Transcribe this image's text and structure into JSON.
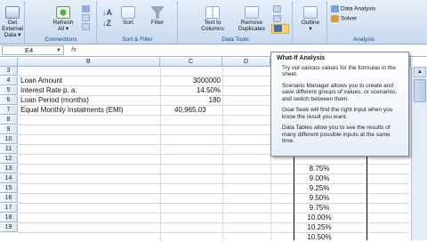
{
  "ribbon": {
    "get_external_data": {
      "line1": "Get External",
      "line2": "Data ▾"
    },
    "connections": {
      "refresh_line1": "Refresh",
      "refresh_line2": "All ▾",
      "group_label": "Connections"
    },
    "sort_filter": {
      "sort": "Sort",
      "filter": "Filter",
      "group_label": "Sort & Filter"
    },
    "data_tools": {
      "text_to_columns_line1": "Text to",
      "text_to_columns_line2": "Columns",
      "remove_duplicates_line1": "Remove",
      "remove_duplicates_line2": "Duplicates",
      "group_label": "Data Tools"
    },
    "outline": {
      "label": "Outline",
      "arrow": "▾"
    },
    "analysis": {
      "data_analysis": "Data Analysis",
      "solver": "Solver",
      "group_label": "Analysis"
    }
  },
  "formula_bar": {
    "name_box": "E4",
    "fx": "fx"
  },
  "columns": [
    "B",
    "C",
    "D"
  ],
  "rows": [
    "3",
    "4",
    "5",
    "6",
    "7",
    "8",
    "9",
    "10",
    "11",
    "12",
    "13",
    "14",
    "15",
    "16",
    "17",
    "18",
    "19"
  ],
  "sheet": {
    "loan_amount_label": "Loan Amount",
    "loan_amount_value": "3000000",
    "interest_label": "Interest Rate p. a.",
    "interest_value": "14.50%",
    "period_label": "Loan Period (months)",
    "period_value": "180",
    "emi_label": "Equal Monthly Instalments (EMI)",
    "emi_value": "40,965.03"
  },
  "rates": [
    "8.75%",
    "9.00%",
    "9.25%",
    "9.50%",
    "9.75%",
    "10.00%",
    "10.25%",
    "10.50%"
  ],
  "tooltip": {
    "title": "What-If Analysis",
    "p1": "Try out various values for the formulas in the sheet.",
    "p2": "Scenario Manager allows you to create and save different groups of values, or scenarios, and switch between them.",
    "p3": "Goal Seek will find the right input when you know the result you want.",
    "p4": "Data Tables allow you to see the results of many different possible inputs at the same time."
  },
  "colors": {
    "ribbon_top": "#e6eef9",
    "ribbon_bottom": "#c9daf0",
    "header_blue": "#dbe5f3",
    "group_label": "#15428b"
  }
}
